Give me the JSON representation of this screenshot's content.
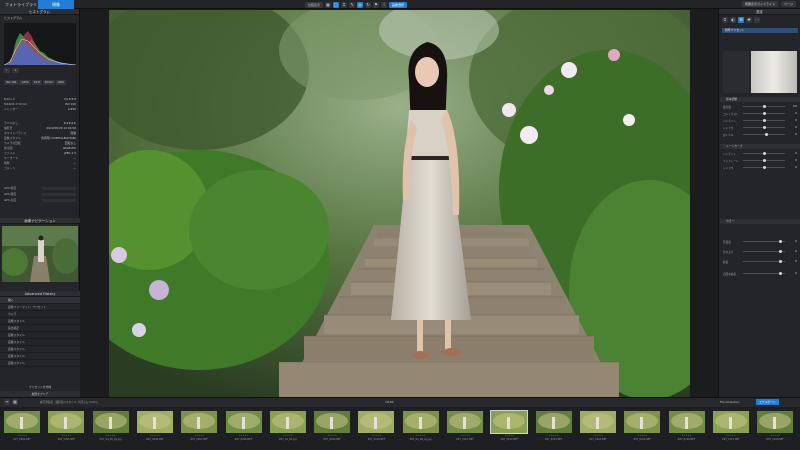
{
  "topbar": {
    "library_tab": "フォトライブラリ",
    "develop_tab": "現像",
    "tools": [
      "比較表示",
      "画像選択"
    ],
    "right_items": [
      "概要表示ガイドライト",
      "ページ"
    ]
  },
  "left_panel": {
    "header": "ヒストグラム",
    "histogram_header": "ヒストグラム",
    "info_rows": [
      {
        "label": "Nikon Z",
        "value": "f/2.8 8.8"
      },
      {
        "label": "NIKKOR Z 50mm",
        "value": "ISO 100"
      },
      {
        "label": "シャッター",
        "value": "1/250"
      }
    ],
    "metadata_rows": [
      {
        "label": "ラベルなし",
        "value": "★★★★★"
      },
      {
        "label": "撮影日",
        "value": "2022/06/26 10:04:56"
      },
      {
        "label": "ホワイトバランス",
        "value": "自動"
      },
      {
        "label": "画像スタイル",
        "value": "色再現 (CONFIGURATION)"
      },
      {
        "label": "カメラの回転",
        "value": "回転なし"
      },
      {
        "label": "色空間",
        "value": "sRGB-IEC"
      },
      {
        "label": "ファイル",
        "value": "JPEG 2.5"
      },
      {
        "label": "キーワード",
        "value": "—"
      },
      {
        "label": "場所",
        "value": "—"
      },
      {
        "label": "コメント",
        "value": "—"
      }
    ],
    "gps_rows": [
      {
        "label": "GPS 緯度",
        "value": ""
      },
      {
        "label": "GPS 経度",
        "value": ""
      },
      {
        "label": "GPS 高度",
        "value": ""
      }
    ],
    "navigator_header": "画像ナビゲーション",
    "advanced_header": "Advanced History",
    "advanced_items": [
      "開く",
      "画像フォーマット: プリセット",
      "カメラ",
      "画像スタイル",
      "露出補正",
      "画像スタイル",
      "画像スタイル",
      "画像スタイル",
      "画像スタイル",
      "画像スタイル"
    ],
    "footer_left": "プリセットを作成",
    "footer_right": "履歴をクリア"
  },
  "right_panel": {
    "header": "設定",
    "preset_label": "標準プリセット",
    "sections": [
      {
        "title": "基本調整",
        "sliders": [
          {
            "label": "露光量",
            "value": "0.0",
            "pos": 0.5
          },
          {
            "label": "コントラスト",
            "value": "0",
            "pos": 0.5
          },
          {
            "label": "ハイライト",
            "value": "0",
            "pos": 0.5
          },
          {
            "label": "シャドウ",
            "value": "0",
            "pos": 0.5
          },
          {
            "label": "白レベル",
            "value": "0",
            "pos": 0.55
          }
        ]
      },
      {
        "title": "トーンカーブ",
        "sliders": [
          {
            "label": "ハイライト",
            "value": "0",
            "pos": 0.5
          },
          {
            "label": "ミッドトーン",
            "value": "0",
            "pos": 0.5
          },
          {
            "label": "シャドウ",
            "value": "0",
            "pos": 0.5
          }
        ]
      },
      {
        "title": "カラー",
        "sliders": [
          {
            "label": "色温度",
            "value": "0",
            "pos": 0.9
          },
          {
            "label": "色かぶり",
            "value": "0",
            "pos": 0.9
          },
          {
            "label": "彩度",
            "value": "0",
            "pos": 0.9
          },
          {
            "label": "自然な彩度",
            "value": "0",
            "pos": 0.9
          }
        ]
      }
    ]
  },
  "filmstrip": {
    "counter": "1/102",
    "info": "被写界深度 : 撮影者のスタイル, 大西さん (Yoshi)",
    "collection": "File Collection",
    "export": "エクスポート",
    "thumbs": [
      {
        "name": "Z97_0094.NEF"
      },
      {
        "name": "Z97_0095.NEF"
      },
      {
        "name": "Z97_04_06_bg.jpg"
      },
      {
        "name": "Z97_0096.NEF"
      },
      {
        "name": "Z97_0097.NEF"
      },
      {
        "name": "Z97_0098.NEF"
      },
      {
        "name": "Z97_04_06.jpg"
      },
      {
        "name": "Z97_0099.NEF"
      },
      {
        "name": "Z97_0100.NEF"
      },
      {
        "name": "Z97_04_06_bg.jpg"
      },
      {
        "name": "Z97_0101.NEF"
      },
      {
        "name": "Z97_0102.NEF"
      },
      {
        "name": "Z97_0103.NEF"
      },
      {
        "name": "Z97_0104.NEF"
      },
      {
        "name": "Z97_0105.NEF"
      },
      {
        "name": "Z97_0106.NEF"
      },
      {
        "name": "Z97_0107.NEF"
      },
      {
        "name": "Z97_0108.NEF"
      }
    ]
  },
  "colors": {
    "accent": "#1f7fd6",
    "panel": "#232528",
    "background": "#1a1b1d"
  }
}
